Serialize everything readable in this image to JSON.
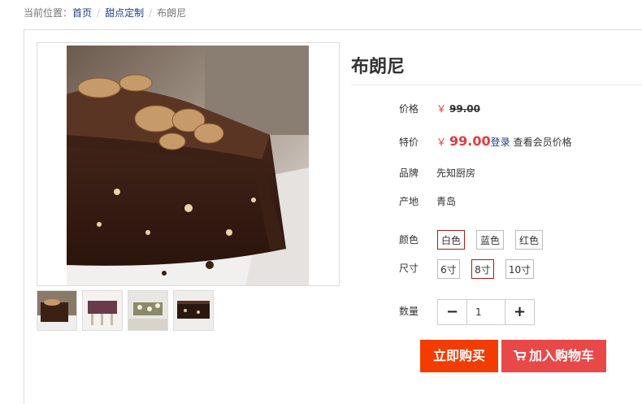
{
  "breadcrumb": {
    "prefix": "当前位置：",
    "items": [
      "首页",
      "甜点定制"
    ],
    "current": "布朗尼"
  },
  "product": {
    "title": "布朗尼",
    "price_label": "价格",
    "currency": "￥",
    "price": "99.00",
    "special_label": "特价",
    "special_price": "99.00",
    "login_link": "登录",
    "member_text": "查看会员价格",
    "brand_label": "品牌",
    "brand": "先知厨房",
    "origin_label": "产地",
    "origin": "青岛"
  },
  "options": {
    "color_label": "颜色",
    "colors": [
      "白色",
      "蓝色",
      "红色"
    ],
    "selected_color": "白色",
    "size_label": "尺寸",
    "sizes": [
      "6寸",
      "8寸",
      "10寸"
    ],
    "selected_size": "8寸"
  },
  "quantity": {
    "label": "数量",
    "value": "1",
    "minus": "−",
    "plus": "+"
  },
  "actions": {
    "buy_now": "立即购买",
    "add_to_cart": "加入购物车"
  },
  "icons": [
    "minus-icon",
    "plus-icon",
    "cart-icon"
  ],
  "colors": {
    "accent": "#f23c00",
    "cart": "#e94849",
    "price": "#e4393c",
    "link": "#1f3f86",
    "selected_border": "#a61b1b"
  }
}
